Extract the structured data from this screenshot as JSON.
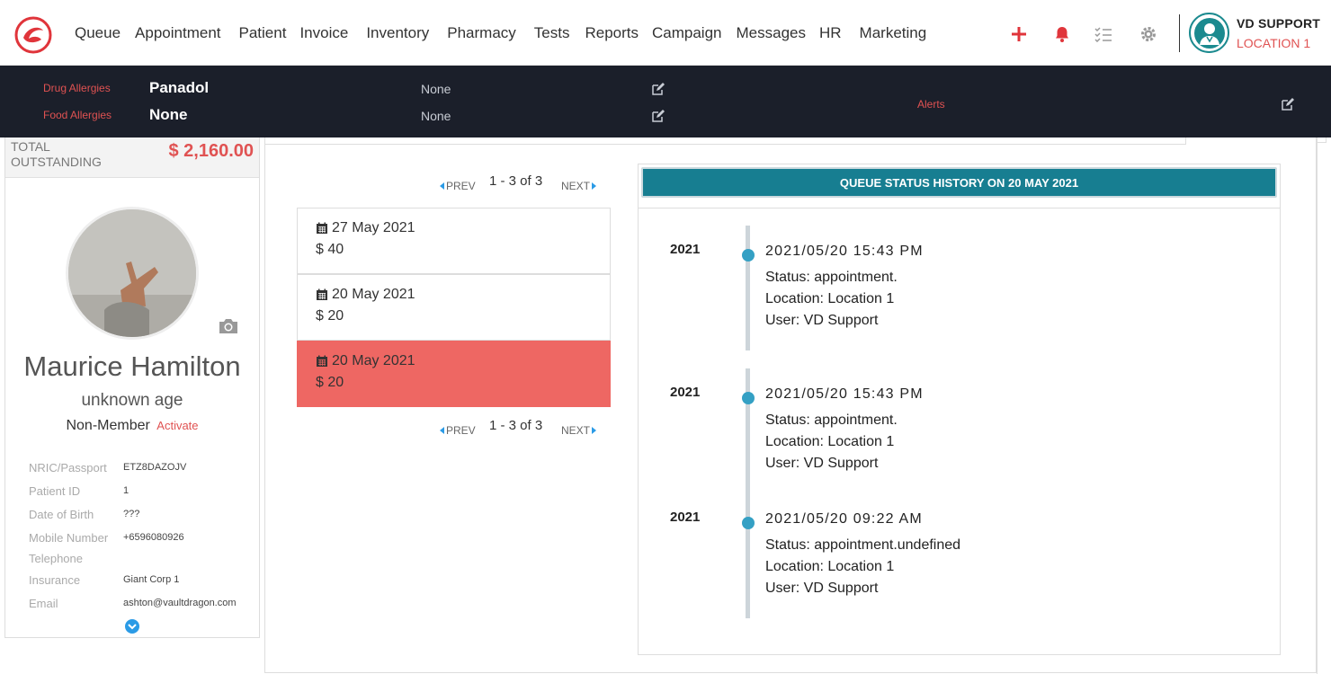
{
  "nav": {
    "items": [
      "Queue",
      "Appointment",
      "Patient",
      "Invoice",
      "Inventory",
      "Pharmacy",
      "Tests",
      "Reports",
      "Campaign",
      "Messages",
      "HR",
      "Marketing"
    ],
    "actions": [
      "plus-icon",
      "bell-icon",
      "checklist-icon",
      "gear-icon"
    ],
    "user": {
      "name": "VD SUPPORT",
      "location": "LOCATION 1"
    }
  },
  "allergies": {
    "drug_label": "Drug Allergies",
    "drug_value": "Panadol",
    "drug_note": "None",
    "food_label": "Food Allergies",
    "food_value": "None",
    "food_note": "None",
    "alerts_label": "Alerts"
  },
  "patient": {
    "outstanding_label_1": "TOTAL",
    "outstanding_label_2": "OUTSTANDING",
    "outstanding_amount": "$ 2,160.00",
    "name": "Maurice Hamilton",
    "age": "unknown age",
    "membership": "Non-Member",
    "activate_label": "Activate",
    "info": [
      {
        "label": "NRIC/Passport",
        "value": "ETZ8DAZOJV"
      },
      {
        "label": "Patient ID",
        "value": "1"
      },
      {
        "label": "Date of Birth",
        "value": "???"
      },
      {
        "label": "Mobile Number",
        "value": "+6596080926"
      },
      {
        "label": "Telephone",
        "value": ""
      },
      {
        "label": "Insurance",
        "value": "Giant Corp 1"
      },
      {
        "label": "Email",
        "value": "ashton@vaultdragon.com"
      }
    ]
  },
  "pager": {
    "prev": "PREV",
    "next": "NEXT",
    "count": "1 - 3 of 3"
  },
  "appointments": [
    {
      "date": "27 May 2021",
      "amount": "$ 40"
    },
    {
      "date": "20 May 2021",
      "amount": "$ 20"
    },
    {
      "date": "20 May 2021",
      "amount": "$ 20"
    }
  ],
  "queue_history": {
    "title": "QUEUE STATUS HISTORY ON 20 MAY 2021",
    "entries": [
      {
        "year": "2021",
        "time": "2021/05/20 15:43 PM",
        "status": "Status:  appointment.",
        "location": "Location: Location 1",
        "user": "User: VD Support"
      },
      {
        "year": "2021",
        "time": "2021/05/20 15:43 PM",
        "status": "Status:  appointment.",
        "location": "Location: Location 1",
        "user": "User: VD Support"
      },
      {
        "year": "2021",
        "time": "2021/05/20 09:22 AM",
        "status": "Status:  appointment.undefined",
        "location": "Location: Location 1",
        "user": "User: VD Support"
      }
    ]
  },
  "colors": {
    "accent_red": "#e05252",
    "teal": "#177e91",
    "dark_bar": "#1b1f2a",
    "active_card": "#ee6763",
    "timeline_dot": "#34a0c4"
  }
}
